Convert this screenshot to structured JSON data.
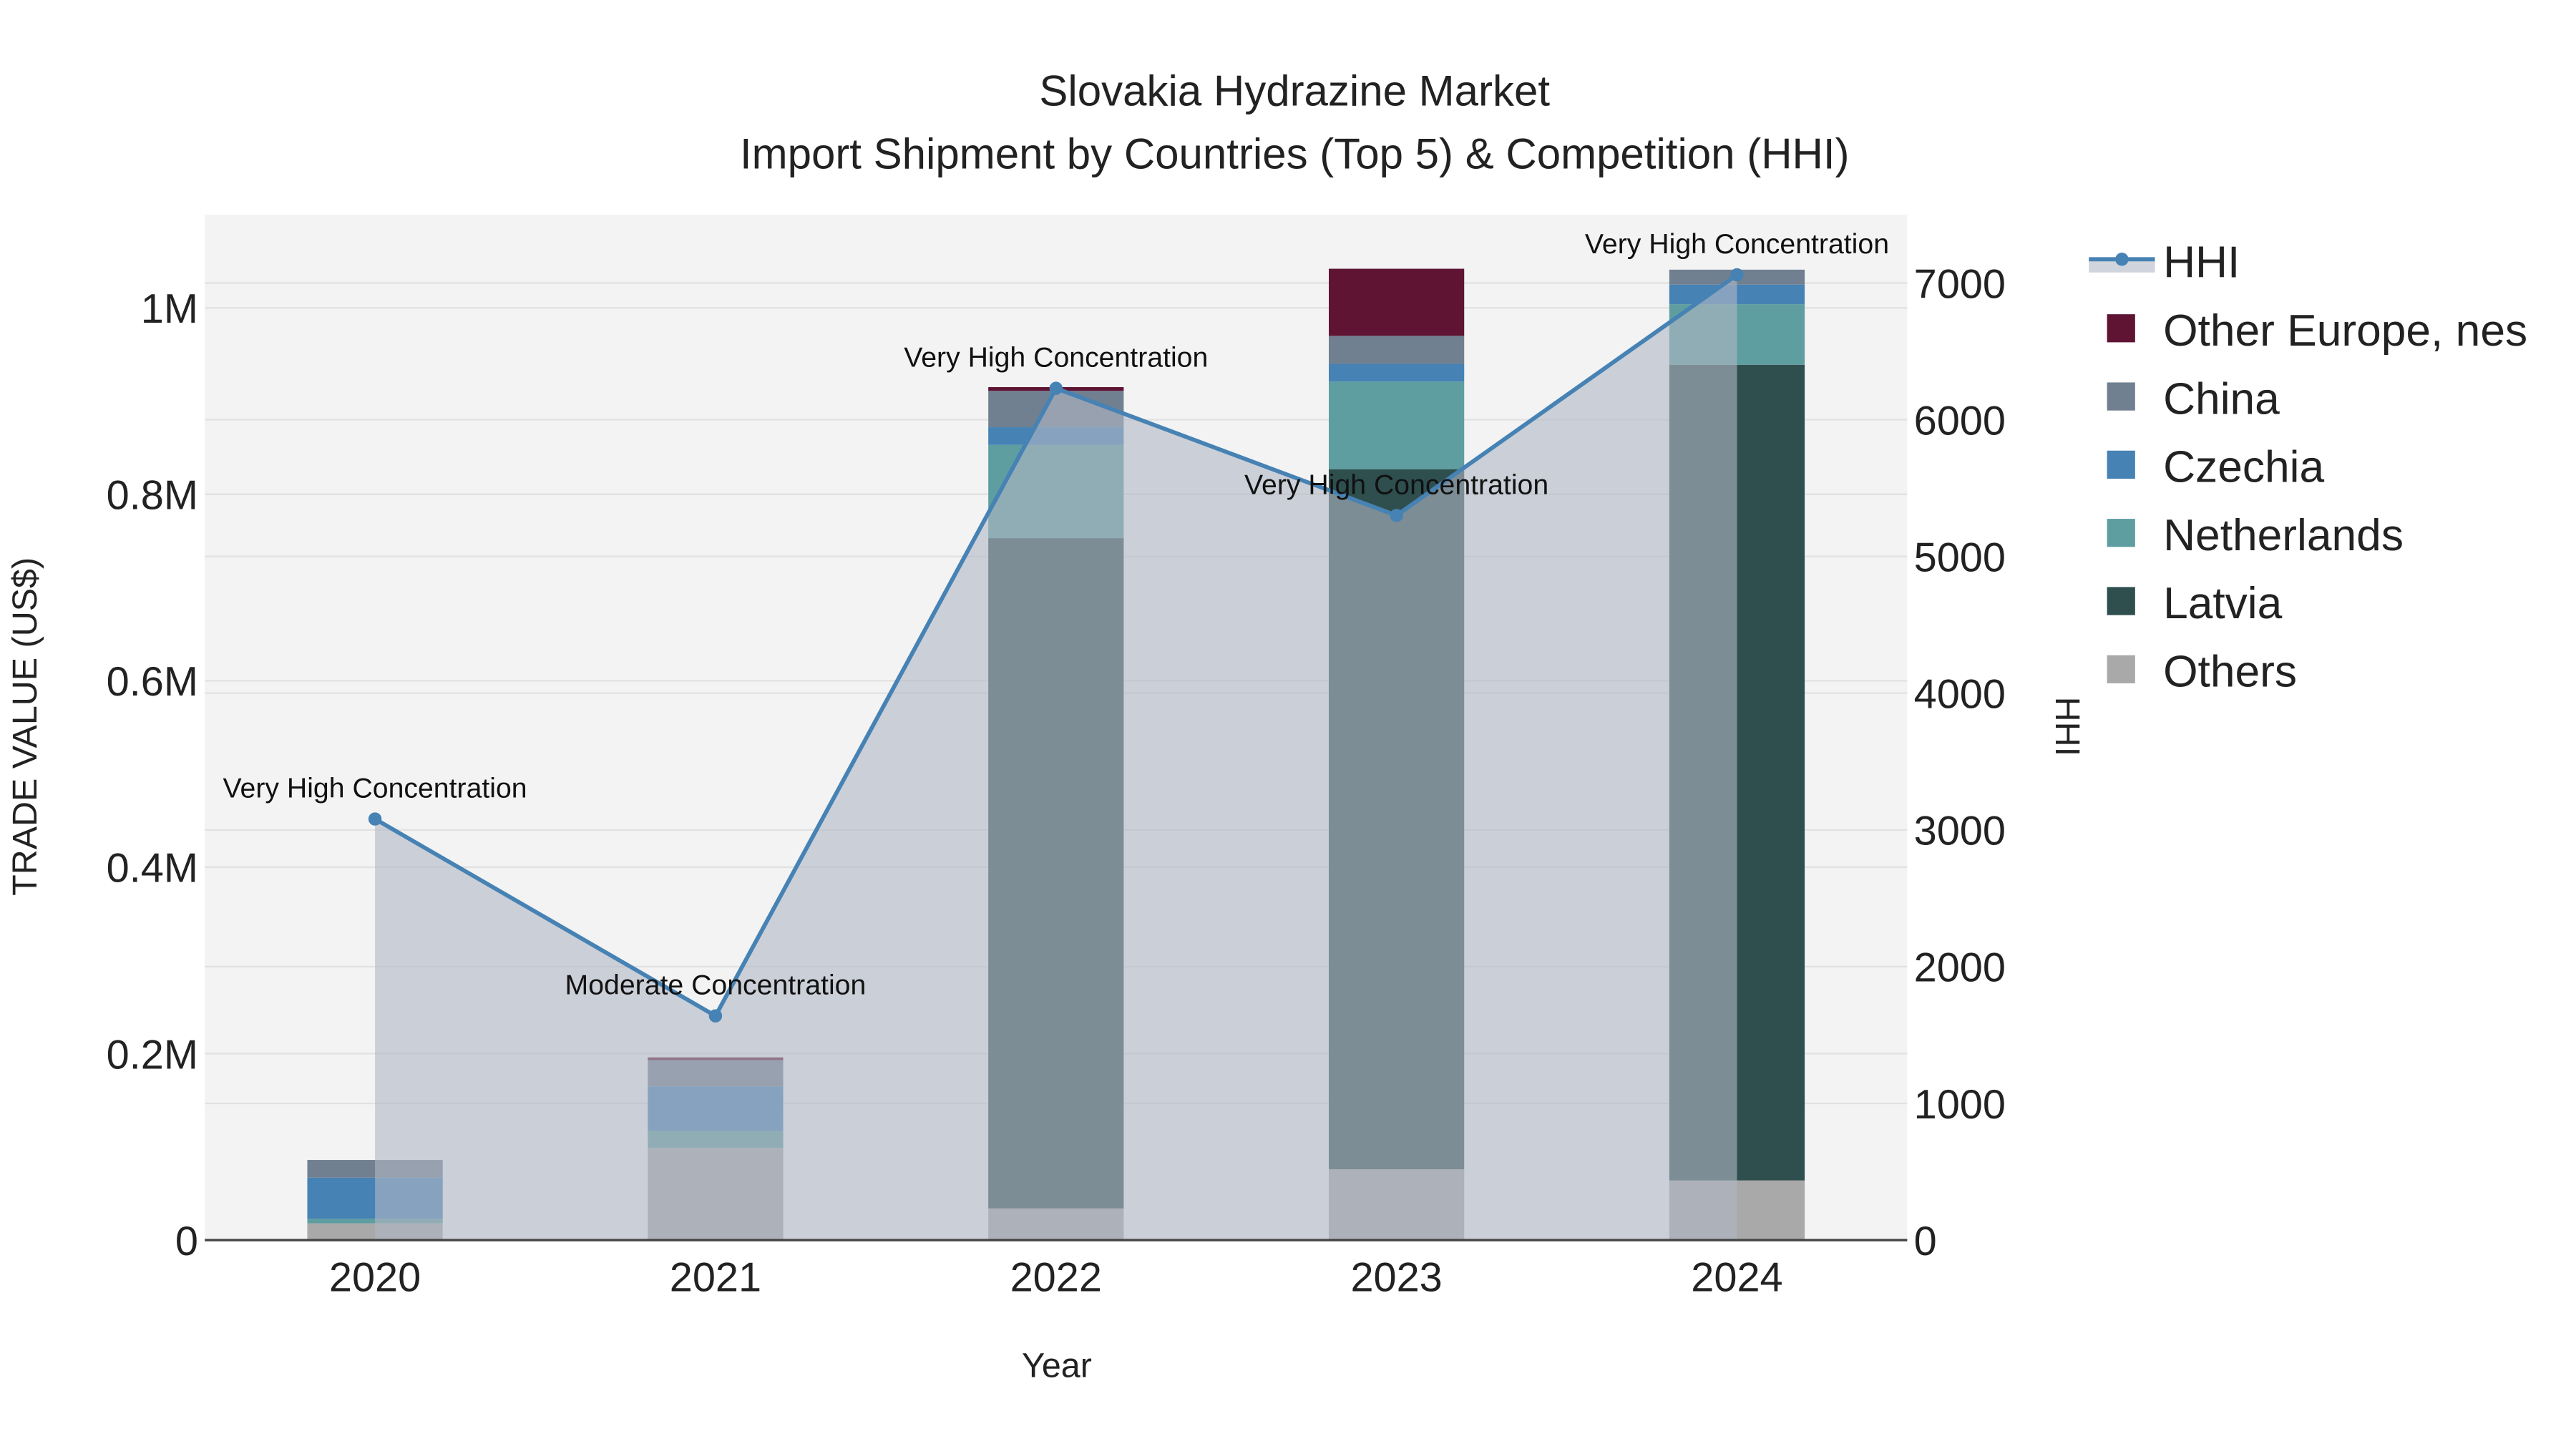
{
  "chart_data": {
    "type": "bar",
    "title": "Slovakia Hydrazine Market",
    "subtitle": "Import Shipment by Countries (Top 5) & Competition (HHI)",
    "xlabel": "Year",
    "ylabel": "TRADE VALUE (US$)",
    "y2label": "HHI",
    "categories": [
      "2020",
      "2021",
      "2022",
      "2023",
      "2024"
    ],
    "ylim": [
      0,
      1100000
    ],
    "y2lim": [
      0,
      7500
    ],
    "yticks": [
      {
        "v": 0,
        "label": "0"
      },
      {
        "v": 200000,
        "label": "0.2M"
      },
      {
        "v": 400000,
        "label": "0.4M"
      },
      {
        "v": 600000,
        "label": "0.6M"
      },
      {
        "v": 800000,
        "label": "0.8M"
      },
      {
        "v": 1000000,
        "label": "1M"
      }
    ],
    "y2ticks": [
      0,
      1000,
      2000,
      3000,
      4000,
      5000,
      6000,
      7000
    ],
    "series": [
      {
        "name": "Others",
        "color": "#a9a9a9",
        "values": [
          18000,
          99000,
          34000,
          76000,
          64000
        ]
      },
      {
        "name": "Latvia",
        "color": "#2f4f4f",
        "values": [
          0,
          0,
          719000,
          751000,
          875000
        ]
      },
      {
        "name": "Netherlands",
        "color": "#5f9ea0",
        "values": [
          5000,
          18000,
          100000,
          94000,
          65000
        ]
      },
      {
        "name": "Czechia",
        "color": "#4682b4",
        "values": [
          44000,
          48000,
          19000,
          19000,
          21000
        ]
      },
      {
        "name": "China",
        "color": "#708090",
        "values": [
          19000,
          28000,
          39000,
          30000,
          16000
        ]
      },
      {
        "name": "Other Europe, nes",
        "color": "#5f1434",
        "values": [
          0,
          3000,
          4000,
          72000,
          0
        ]
      }
    ],
    "hhi": {
      "name": "HHI",
      "color": "#4682b4",
      "values": [
        3080,
        1640,
        6230,
        5300,
        7060
      ],
      "annotations": [
        "Very High Concentration",
        "Moderate Concentration",
        "Very High Concentration",
        "Very High Concentration",
        "Very High Concentration"
      ]
    },
    "legend": [
      "HHI",
      "Other Europe, nes",
      "China",
      "Czechia",
      "Netherlands",
      "Latvia",
      "Others"
    ],
    "legend_placement": "right",
    "grid": true
  }
}
